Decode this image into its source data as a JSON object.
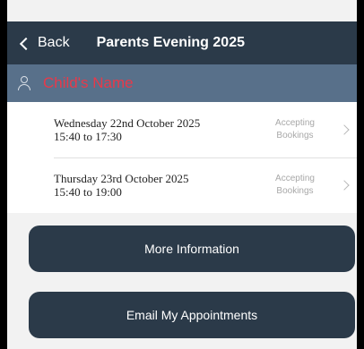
{
  "nav": {
    "back_label": "Back",
    "title": "Parents Evening 2025"
  },
  "child": {
    "name": "Child's Name",
    "name_color": "#e8394a"
  },
  "evenings": [
    {
      "line1": "Wednesday 22nd October 2025",
      "line2": "15:40 to 17:30",
      "status_line1": "Accepting",
      "status_line2": "Bookings"
    },
    {
      "line1": "Thursday 23rd October 2025",
      "line2": "15:40 to 19:00",
      "status_line1": "Accepting",
      "status_line2": "Bookings"
    }
  ],
  "buttons": {
    "more_info": "More Information",
    "email": "Email My Appointments"
  },
  "colors": {
    "nav_background": "#2b3a49",
    "child_bar_background": "#58708a",
    "button_background": "#2b3a49"
  }
}
